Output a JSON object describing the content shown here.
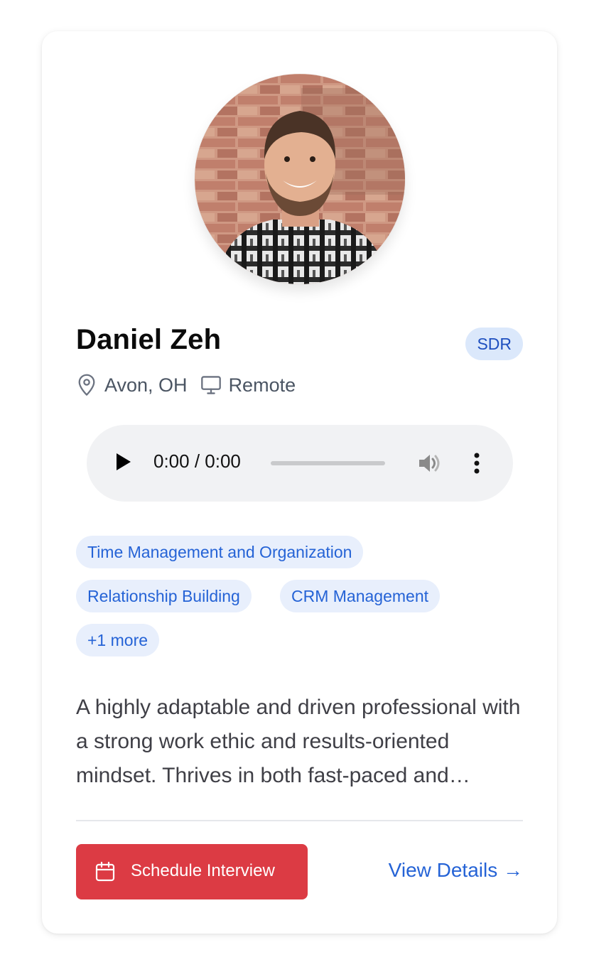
{
  "candidate": {
    "name": "Daniel Zeh",
    "role": "SDR",
    "location": "Avon, OH",
    "work_mode": "Remote"
  },
  "audio": {
    "time": "0:00 / 0:00"
  },
  "skills": [
    "Time Management and Organization",
    "Relationship Building",
    "CRM Management",
    "+1 more"
  ],
  "description": "A highly adaptable and driven professional with a strong work ethic and results-oriented mindset. Thrives in both fast-paced and collaborative environments, bringing energy and focus to every role.",
  "actions": {
    "schedule_label": "Schedule Interview",
    "view_details_label": "View Details →"
  },
  "colors": {
    "accent_red": "#dc3b44",
    "link_blue": "#2563d6",
    "badge_bg": "#dbe8fb",
    "tag_bg": "#e8effc"
  },
  "icons": {
    "location": "map-pin-icon",
    "work_mode": "monitor-icon",
    "schedule": "calendar-icon",
    "audio_play": "play-icon",
    "audio_volume": "volume-icon",
    "audio_more": "more-vertical-icon"
  }
}
